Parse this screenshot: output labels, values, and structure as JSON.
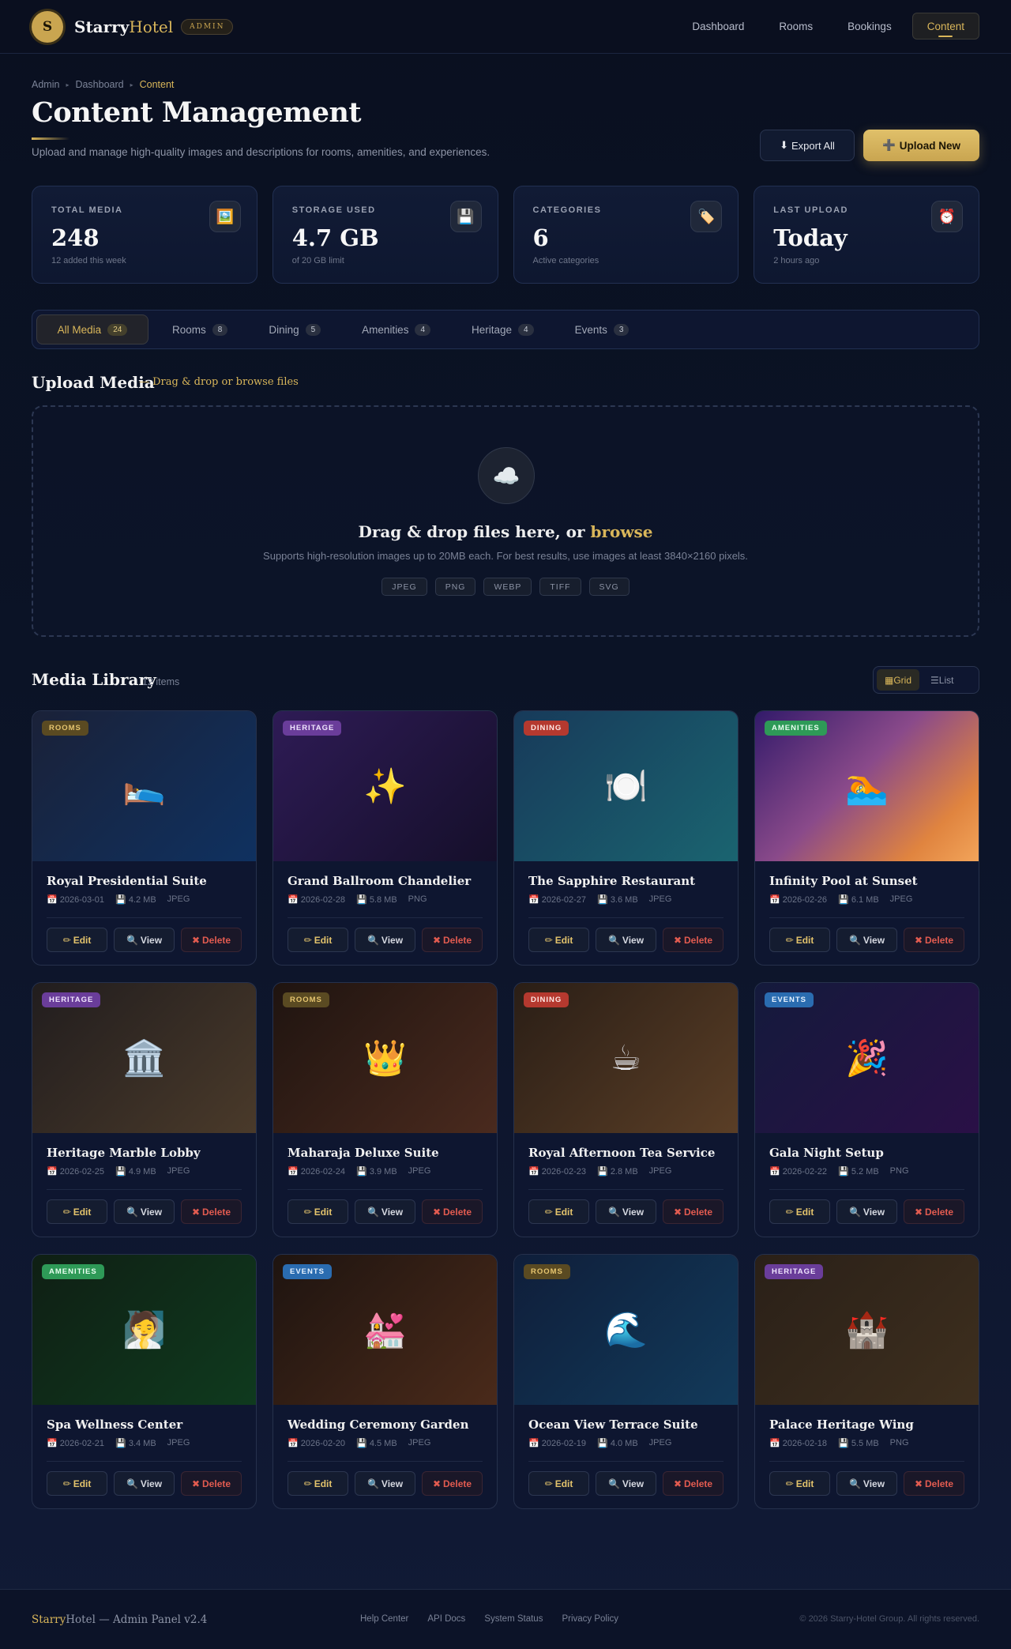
{
  "brand": {
    "logo_letter": "S",
    "name_part1": "Starry",
    "name_part2": "Hotel",
    "badge": "ADMIN"
  },
  "nav": [
    {
      "label": "Dashboard",
      "active": false
    },
    {
      "label": "Rooms",
      "active": false
    },
    {
      "label": "Bookings",
      "active": false
    },
    {
      "label": "Content",
      "active": true
    }
  ],
  "breadcrumb": [
    "Admin",
    "Dashboard",
    "Content"
  ],
  "page": {
    "title": "Content Management",
    "subtitle": "Upload and manage high-quality images and descriptions for rooms, amenities, and experiences.",
    "export_label": "Export All",
    "upload_label": "Upload New"
  },
  "stats": [
    {
      "label": "TOTAL MEDIA",
      "value": "248",
      "sub": "12 added this week",
      "icon": "image-icon",
      "glyph": "🖼️"
    },
    {
      "label": "STORAGE USED",
      "value": "4.7 GB",
      "sub": "of 20 GB limit",
      "icon": "floppy-disk-icon",
      "glyph": "💾"
    },
    {
      "label": "CATEGORIES",
      "value": "6",
      "sub": "Active categories",
      "icon": "tag-icon",
      "glyph": "🏷️"
    },
    {
      "label": "LAST UPLOAD",
      "value": "Today",
      "sub": "2 hours ago",
      "icon": "alarm-clock-icon",
      "glyph": "⏰"
    }
  ],
  "tabs": [
    {
      "label": "All Media",
      "count": "24",
      "active": true
    },
    {
      "label": "Rooms",
      "count": "8",
      "active": false
    },
    {
      "label": "Dining",
      "count": "5",
      "active": false
    },
    {
      "label": "Amenities",
      "count": "4",
      "active": false
    },
    {
      "label": "Heritage",
      "count": "4",
      "active": false
    },
    {
      "label": "Events",
      "count": "3",
      "active": false
    }
  ],
  "upload": {
    "section_title": "Upload Media",
    "section_hint": "— Drag & drop or browse files",
    "drop_title": "Drag & drop files here, or",
    "drop_link": "browse",
    "drop_desc": "Supports high-resolution images up to 20MB each. For best results, use images at least 3840×2160 pixels.",
    "formats": [
      "JPEG",
      "PNG",
      "WEBP",
      "TIFF",
      "SVG"
    ]
  },
  "library": {
    "title": "Media Library",
    "count": "12 items",
    "views": [
      {
        "label": "Grid",
        "icon": "▦",
        "active": true
      },
      {
        "label": "List",
        "icon": "☰",
        "active": false
      }
    ],
    "actions": {
      "edit": "Edit",
      "view": "View",
      "delete": "Delete"
    },
    "items": [
      {
        "tag": "ROOMS",
        "tag_bg": "#5a4a22",
        "tag_fg": "#e6c56f",
        "icon": "bed-icon",
        "glyph": "🛌",
        "bg": "linear-gradient(135deg,#1a2138,#0f3160)",
        "title": "Royal Presidential Suite",
        "date": "2026-03-01",
        "size": "4.2 MB",
        "type": "JPEG"
      },
      {
        "tag": "HERITAGE",
        "tag_bg": "#6a3d9a",
        "tag_fg": "#f1e6ff",
        "icon": "sparkles-icon",
        "glyph": "✨",
        "bg": "linear-gradient(135deg,#2e1b55,#150f2a)",
        "title": "Grand Ballroom Chandelier",
        "date": "2026-02-28",
        "size": "5.8 MB",
        "type": "PNG"
      },
      {
        "tag": "DINING",
        "tag_bg": "#b5392f",
        "tag_fg": "#ffe9e6",
        "icon": "plate-icon",
        "glyph": "🍽️",
        "bg": "linear-gradient(135deg,#173a5a,#1a6470)",
        "title": "The Sapphire Restaurant",
        "date": "2026-02-27",
        "size": "3.6 MB",
        "type": "JPEG"
      },
      {
        "tag": "AMENITIES",
        "tag_bg": "#2e9a57",
        "tag_fg": "#e8fff0",
        "icon": "swimmer-icon",
        "glyph": "🏊",
        "bg": "linear-gradient(135deg,#321a6a,#8a4a8a 45%,#e0843f 80%,#f2a45a)",
        "title": "Infinity Pool at Sunset",
        "date": "2026-02-26",
        "size": "6.1 MB",
        "type": "JPEG"
      },
      {
        "tag": "HERITAGE",
        "tag_bg": "#6a3d9a",
        "tag_fg": "#f1e6ff",
        "icon": "classical-building-icon",
        "glyph": "🏛️",
        "bg": "linear-gradient(135deg,#211d1e,#4a3a2a)",
        "title": "Heritage Marble Lobby",
        "date": "2026-02-25",
        "size": "4.9 MB",
        "type": "JPEG"
      },
      {
        "tag": "ROOMS",
        "tag_bg": "#5a4a22",
        "tag_fg": "#e6c56f",
        "icon": "crown-icon",
        "glyph": "👑",
        "bg": "linear-gradient(135deg,#1f1410,#4a2a1e)",
        "title": "Maharaja Deluxe Suite",
        "date": "2026-02-24",
        "size": "3.9 MB",
        "type": "JPEG"
      },
      {
        "tag": "DINING",
        "tag_bg": "#b5392f",
        "tag_fg": "#ffe9e6",
        "icon": "coffee-icon",
        "glyph": "☕",
        "bg": "linear-gradient(135deg,#2a1e16,#5a3e26)",
        "title": "Royal Afternoon Tea Service",
        "date": "2026-02-23",
        "size": "2.8 MB",
        "type": "JPEG"
      },
      {
        "tag": "EVENTS",
        "tag_bg": "#2a6cb0",
        "tag_fg": "#e6f2ff",
        "icon": "party-popper-icon",
        "glyph": "🎉",
        "bg": "linear-gradient(135deg,#141a3c,#2a1046)",
        "title": "Gala Night Setup",
        "date": "2026-02-22",
        "size": "5.2 MB",
        "type": "PNG"
      },
      {
        "tag": "AMENITIES",
        "tag_bg": "#2e9a57",
        "tag_fg": "#e8fff0",
        "icon": "spa-person-icon",
        "glyph": "🧖",
        "bg": "linear-gradient(135deg,#0f1f14,#0f3a1e)",
        "title": "Spa Wellness Center",
        "date": "2026-02-21",
        "size": "3.4 MB",
        "type": "JPEG"
      },
      {
        "tag": "EVENTS",
        "tag_bg": "#2a6cb0",
        "tag_fg": "#e6f2ff",
        "icon": "wedding-icon",
        "glyph": "💒",
        "bg": "linear-gradient(135deg,#1e1410,#4a2a1a)",
        "title": "Wedding Ceremony Garden",
        "date": "2026-02-20",
        "size": "4.5 MB",
        "type": "JPEG"
      },
      {
        "tag": "ROOMS",
        "tag_bg": "#5a4a22",
        "tag_fg": "#e6c56f",
        "icon": "wave-icon",
        "glyph": "🌊",
        "bg": "linear-gradient(135deg,#0f1e3a,#123a5a)",
        "title": "Ocean View Terrace Suite",
        "date": "2026-02-19",
        "size": "4.0 MB",
        "type": "JPEG"
      },
      {
        "tag": "HERITAGE",
        "tag_bg": "#6a3d9a",
        "tag_fg": "#f1e6ff",
        "icon": "castle-icon",
        "glyph": "🏰",
        "bg": "linear-gradient(135deg,#2a2018,#3e2f1e)",
        "title": "Palace Heritage Wing",
        "date": "2026-02-18",
        "size": "5.5 MB",
        "type": "PNG"
      }
    ]
  },
  "footer": {
    "brand_part1": "Starry",
    "brand_part2": "Hotel — Admin Panel v2.4",
    "links": [
      "Help Center",
      "API Docs",
      "System Status",
      "Privacy Policy"
    ],
    "copyright": "© 2026 Starry-Hotel Group. All rights reserved."
  },
  "colors": {
    "accent": "#d9b65a",
    "background": "#0b1326",
    "danger": "#e25b50"
  }
}
